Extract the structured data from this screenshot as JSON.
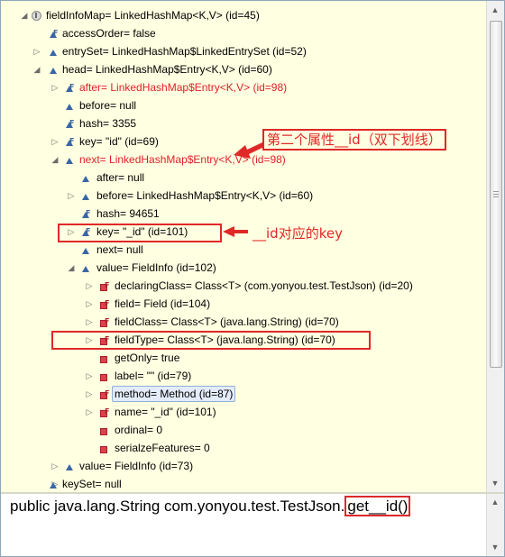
{
  "tree": {
    "rows": [
      {
        "label": "fieldInfoMap= LinkedHashMap<K,V>  (id=45)"
      },
      {
        "label": "accessOrder= false"
      },
      {
        "label": "entrySet= LinkedHashMap$LinkedEntrySet  (id=52)"
      },
      {
        "label": "head= LinkedHashMap$Entry<K,V>  (id=60)"
      },
      {
        "label": "after= LinkedHashMap$Entry<K,V>  (id=98)"
      },
      {
        "label": "before= null"
      },
      {
        "label": "hash= 3355"
      },
      {
        "label": "key= \"id\" (id=69)"
      },
      {
        "label": "next= LinkedHashMap$Entry<K,V>  (id=98)"
      },
      {
        "label": "after= null"
      },
      {
        "label": "before= LinkedHashMap$Entry<K,V>  (id=60)"
      },
      {
        "label": "hash= 94651"
      },
      {
        "label": "key= \"_id\" (id=101)"
      },
      {
        "label": "next= null"
      },
      {
        "label": "value= FieldInfo  (id=102)"
      },
      {
        "label": "declaringClass= Class<T> (com.yonyou.test.TestJson) (id=20)"
      },
      {
        "label": "field= Field  (id=104)"
      },
      {
        "label": "fieldClass= Class<T> (java.lang.String) (id=70)"
      },
      {
        "label": "fieldType= Class<T> (java.lang.String) (id=70)"
      },
      {
        "label": "getOnly= true"
      },
      {
        "label": "label= \"\" (id=79)"
      },
      {
        "label": "method= Method  (id=87)"
      },
      {
        "label": "name= \"_id\" (id=101)"
      },
      {
        "label": "ordinal= 0"
      },
      {
        "label": "serialzeFeatures= 0"
      },
      {
        "label": "value= FieldInfo  (id=73)"
      },
      {
        "label": "keySet= null"
      }
    ]
  },
  "annotations": {
    "second_attr": "第二个属性__id（双下划线）",
    "key_note": "__id对应的key"
  },
  "source": {
    "prefix": "public java.lang.String com.yonyou.test.TestJson.",
    "method": "get__id()"
  },
  "colors": {
    "background": "#ffffe1",
    "highlight_red": "#e02828",
    "field_blue": "#3a66a8",
    "private_red": "#e0404a"
  },
  "icons": {
    "expanded": "tree-expanded-icon",
    "collapsed": "tree-collapsed-icon",
    "public_field": "public-field-icon",
    "private_field": "private-field-icon",
    "final_modifier": "final-modifier-icon",
    "root_variable": "variable-icon"
  }
}
